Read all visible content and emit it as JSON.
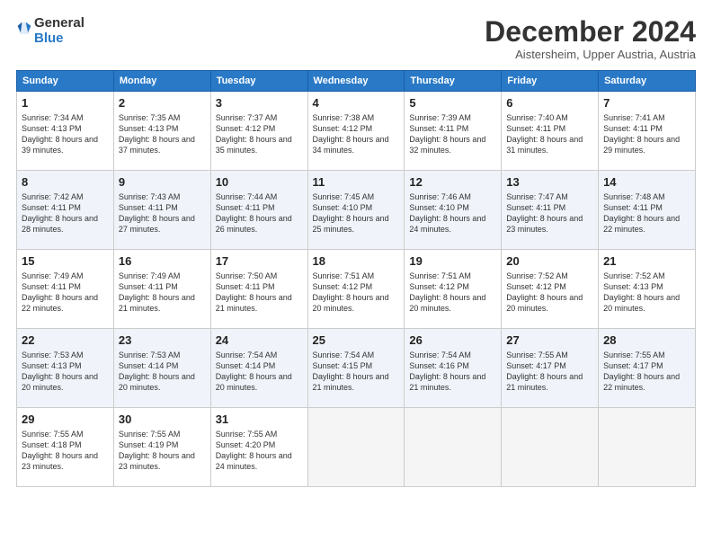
{
  "logo": {
    "line1": "General",
    "line2": "Blue"
  },
  "title": "December 2024",
  "subtitle": "Aistersheim, Upper Austria, Austria",
  "days_of_week": [
    "Sunday",
    "Monday",
    "Tuesday",
    "Wednesday",
    "Thursday",
    "Friday",
    "Saturday"
  ],
  "weeks": [
    [
      {
        "day": 1,
        "sunrise": "7:34 AM",
        "sunset": "4:13 PM",
        "daylight": "8 hours and 39 minutes."
      },
      {
        "day": 2,
        "sunrise": "7:35 AM",
        "sunset": "4:13 PM",
        "daylight": "8 hours and 37 minutes."
      },
      {
        "day": 3,
        "sunrise": "7:37 AM",
        "sunset": "4:12 PM",
        "daylight": "8 hours and 35 minutes."
      },
      {
        "day": 4,
        "sunrise": "7:38 AM",
        "sunset": "4:12 PM",
        "daylight": "8 hours and 34 minutes."
      },
      {
        "day": 5,
        "sunrise": "7:39 AM",
        "sunset": "4:11 PM",
        "daylight": "8 hours and 32 minutes."
      },
      {
        "day": 6,
        "sunrise": "7:40 AM",
        "sunset": "4:11 PM",
        "daylight": "8 hours and 31 minutes."
      },
      {
        "day": 7,
        "sunrise": "7:41 AM",
        "sunset": "4:11 PM",
        "daylight": "8 hours and 29 minutes."
      }
    ],
    [
      {
        "day": 8,
        "sunrise": "7:42 AM",
        "sunset": "4:11 PM",
        "daylight": "8 hours and 28 minutes."
      },
      {
        "day": 9,
        "sunrise": "7:43 AM",
        "sunset": "4:11 PM",
        "daylight": "8 hours and 27 minutes."
      },
      {
        "day": 10,
        "sunrise": "7:44 AM",
        "sunset": "4:11 PM",
        "daylight": "8 hours and 26 minutes."
      },
      {
        "day": 11,
        "sunrise": "7:45 AM",
        "sunset": "4:10 PM",
        "daylight": "8 hours and 25 minutes."
      },
      {
        "day": 12,
        "sunrise": "7:46 AM",
        "sunset": "4:10 PM",
        "daylight": "8 hours and 24 minutes."
      },
      {
        "day": 13,
        "sunrise": "7:47 AM",
        "sunset": "4:11 PM",
        "daylight": "8 hours and 23 minutes."
      },
      {
        "day": 14,
        "sunrise": "7:48 AM",
        "sunset": "4:11 PM",
        "daylight": "8 hours and 22 minutes."
      }
    ],
    [
      {
        "day": 15,
        "sunrise": "7:49 AM",
        "sunset": "4:11 PM",
        "daylight": "8 hours and 22 minutes."
      },
      {
        "day": 16,
        "sunrise": "7:49 AM",
        "sunset": "4:11 PM",
        "daylight": "8 hours and 21 minutes."
      },
      {
        "day": 17,
        "sunrise": "7:50 AM",
        "sunset": "4:11 PM",
        "daylight": "8 hours and 21 minutes."
      },
      {
        "day": 18,
        "sunrise": "7:51 AM",
        "sunset": "4:12 PM",
        "daylight": "8 hours and 20 minutes."
      },
      {
        "day": 19,
        "sunrise": "7:51 AM",
        "sunset": "4:12 PM",
        "daylight": "8 hours and 20 minutes."
      },
      {
        "day": 20,
        "sunrise": "7:52 AM",
        "sunset": "4:12 PM",
        "daylight": "8 hours and 20 minutes."
      },
      {
        "day": 21,
        "sunrise": "7:52 AM",
        "sunset": "4:13 PM",
        "daylight": "8 hours and 20 minutes."
      }
    ],
    [
      {
        "day": 22,
        "sunrise": "7:53 AM",
        "sunset": "4:13 PM",
        "daylight": "8 hours and 20 minutes."
      },
      {
        "day": 23,
        "sunrise": "7:53 AM",
        "sunset": "4:14 PM",
        "daylight": "8 hours and 20 minutes."
      },
      {
        "day": 24,
        "sunrise": "7:54 AM",
        "sunset": "4:14 PM",
        "daylight": "8 hours and 20 minutes."
      },
      {
        "day": 25,
        "sunrise": "7:54 AM",
        "sunset": "4:15 PM",
        "daylight": "8 hours and 21 minutes."
      },
      {
        "day": 26,
        "sunrise": "7:54 AM",
        "sunset": "4:16 PM",
        "daylight": "8 hours and 21 minutes."
      },
      {
        "day": 27,
        "sunrise": "7:55 AM",
        "sunset": "4:17 PM",
        "daylight": "8 hours and 21 minutes."
      },
      {
        "day": 28,
        "sunrise": "7:55 AM",
        "sunset": "4:17 PM",
        "daylight": "8 hours and 22 minutes."
      }
    ],
    [
      {
        "day": 29,
        "sunrise": "7:55 AM",
        "sunset": "4:18 PM",
        "daylight": "8 hours and 23 minutes."
      },
      {
        "day": 30,
        "sunrise": "7:55 AM",
        "sunset": "4:19 PM",
        "daylight": "8 hours and 23 minutes."
      },
      {
        "day": 31,
        "sunrise": "7:55 AM",
        "sunset": "4:20 PM",
        "daylight": "8 hours and 24 minutes."
      },
      null,
      null,
      null,
      null
    ]
  ]
}
